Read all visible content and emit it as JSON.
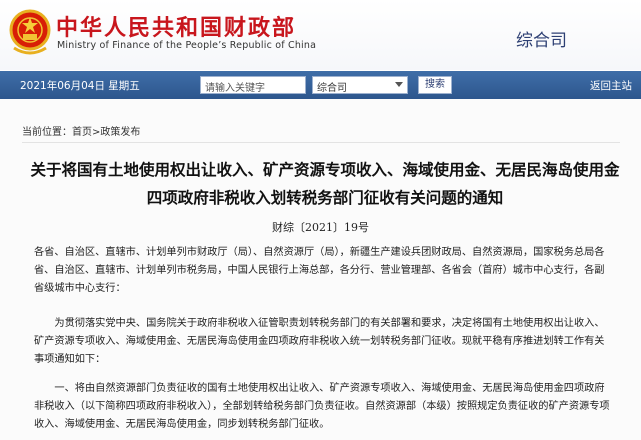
{
  "header": {
    "title_cn": "中华人民共和国财政部",
    "title_en": "Ministry of Finance of the People’s Republic of China",
    "dept": "综合司",
    "colors": {
      "brand_red": "#c8161d",
      "dept_blue": "#2d3f73"
    }
  },
  "navbar": {
    "date": "2021年06月04日 星期五",
    "search_placeholder": "请输入关键字",
    "select_value": "综合司",
    "search_button": "搜索",
    "home_link": "返回主站",
    "color": "#3f6ea8"
  },
  "breadcrumb": {
    "prefix": "当前位置：",
    "home": "首页",
    "separator": ">",
    "section": "政策发布"
  },
  "article": {
    "title": "关于将国有土地使用权出让收入、矿产资源专项收入、海域使用金、无居民海岛使用金四项政府非税收入划转税务部门征收有关问题的通知",
    "doc_number": "财综〔2021〕19号",
    "paragraphs": [
      "各省、自治区、直辖市、计划单列市财政厅（局）、自然资源厅（局），新疆生产建设兵团财政局、自然资源局，国家税务总局各省、自治区、直辖市、计划单列市税务局，中国人民银行上海总部，各分行、营业管理部、各省会（首府）城市中心支行，各副省级城市中心支行：",
      "为贯彻落实党中央、国务院关于政府非税收入征管职责划转税务部门的有关部署和要求，决定将国有土地使用权出让收入、矿产资源专项收入、海域使用金、无居民海岛使用金四项政府非税收入统一划转税务部门征收。现就平稳有序推进划转工作有关事项通知如下：",
      "一、将由自然资源部门负责征收的国有土地使用权出让收入、矿产资源专项收入、海域使用金、无居民海岛使用金四项政府非税收入（以下简称四项政府非税收入），全部划转给税务部门负责征收。自然资源部（本级）按照规定负责征收的矿产资源专项收入、海域使用金、无居民海岛使用金，同步划转税务部门征收。"
    ]
  }
}
